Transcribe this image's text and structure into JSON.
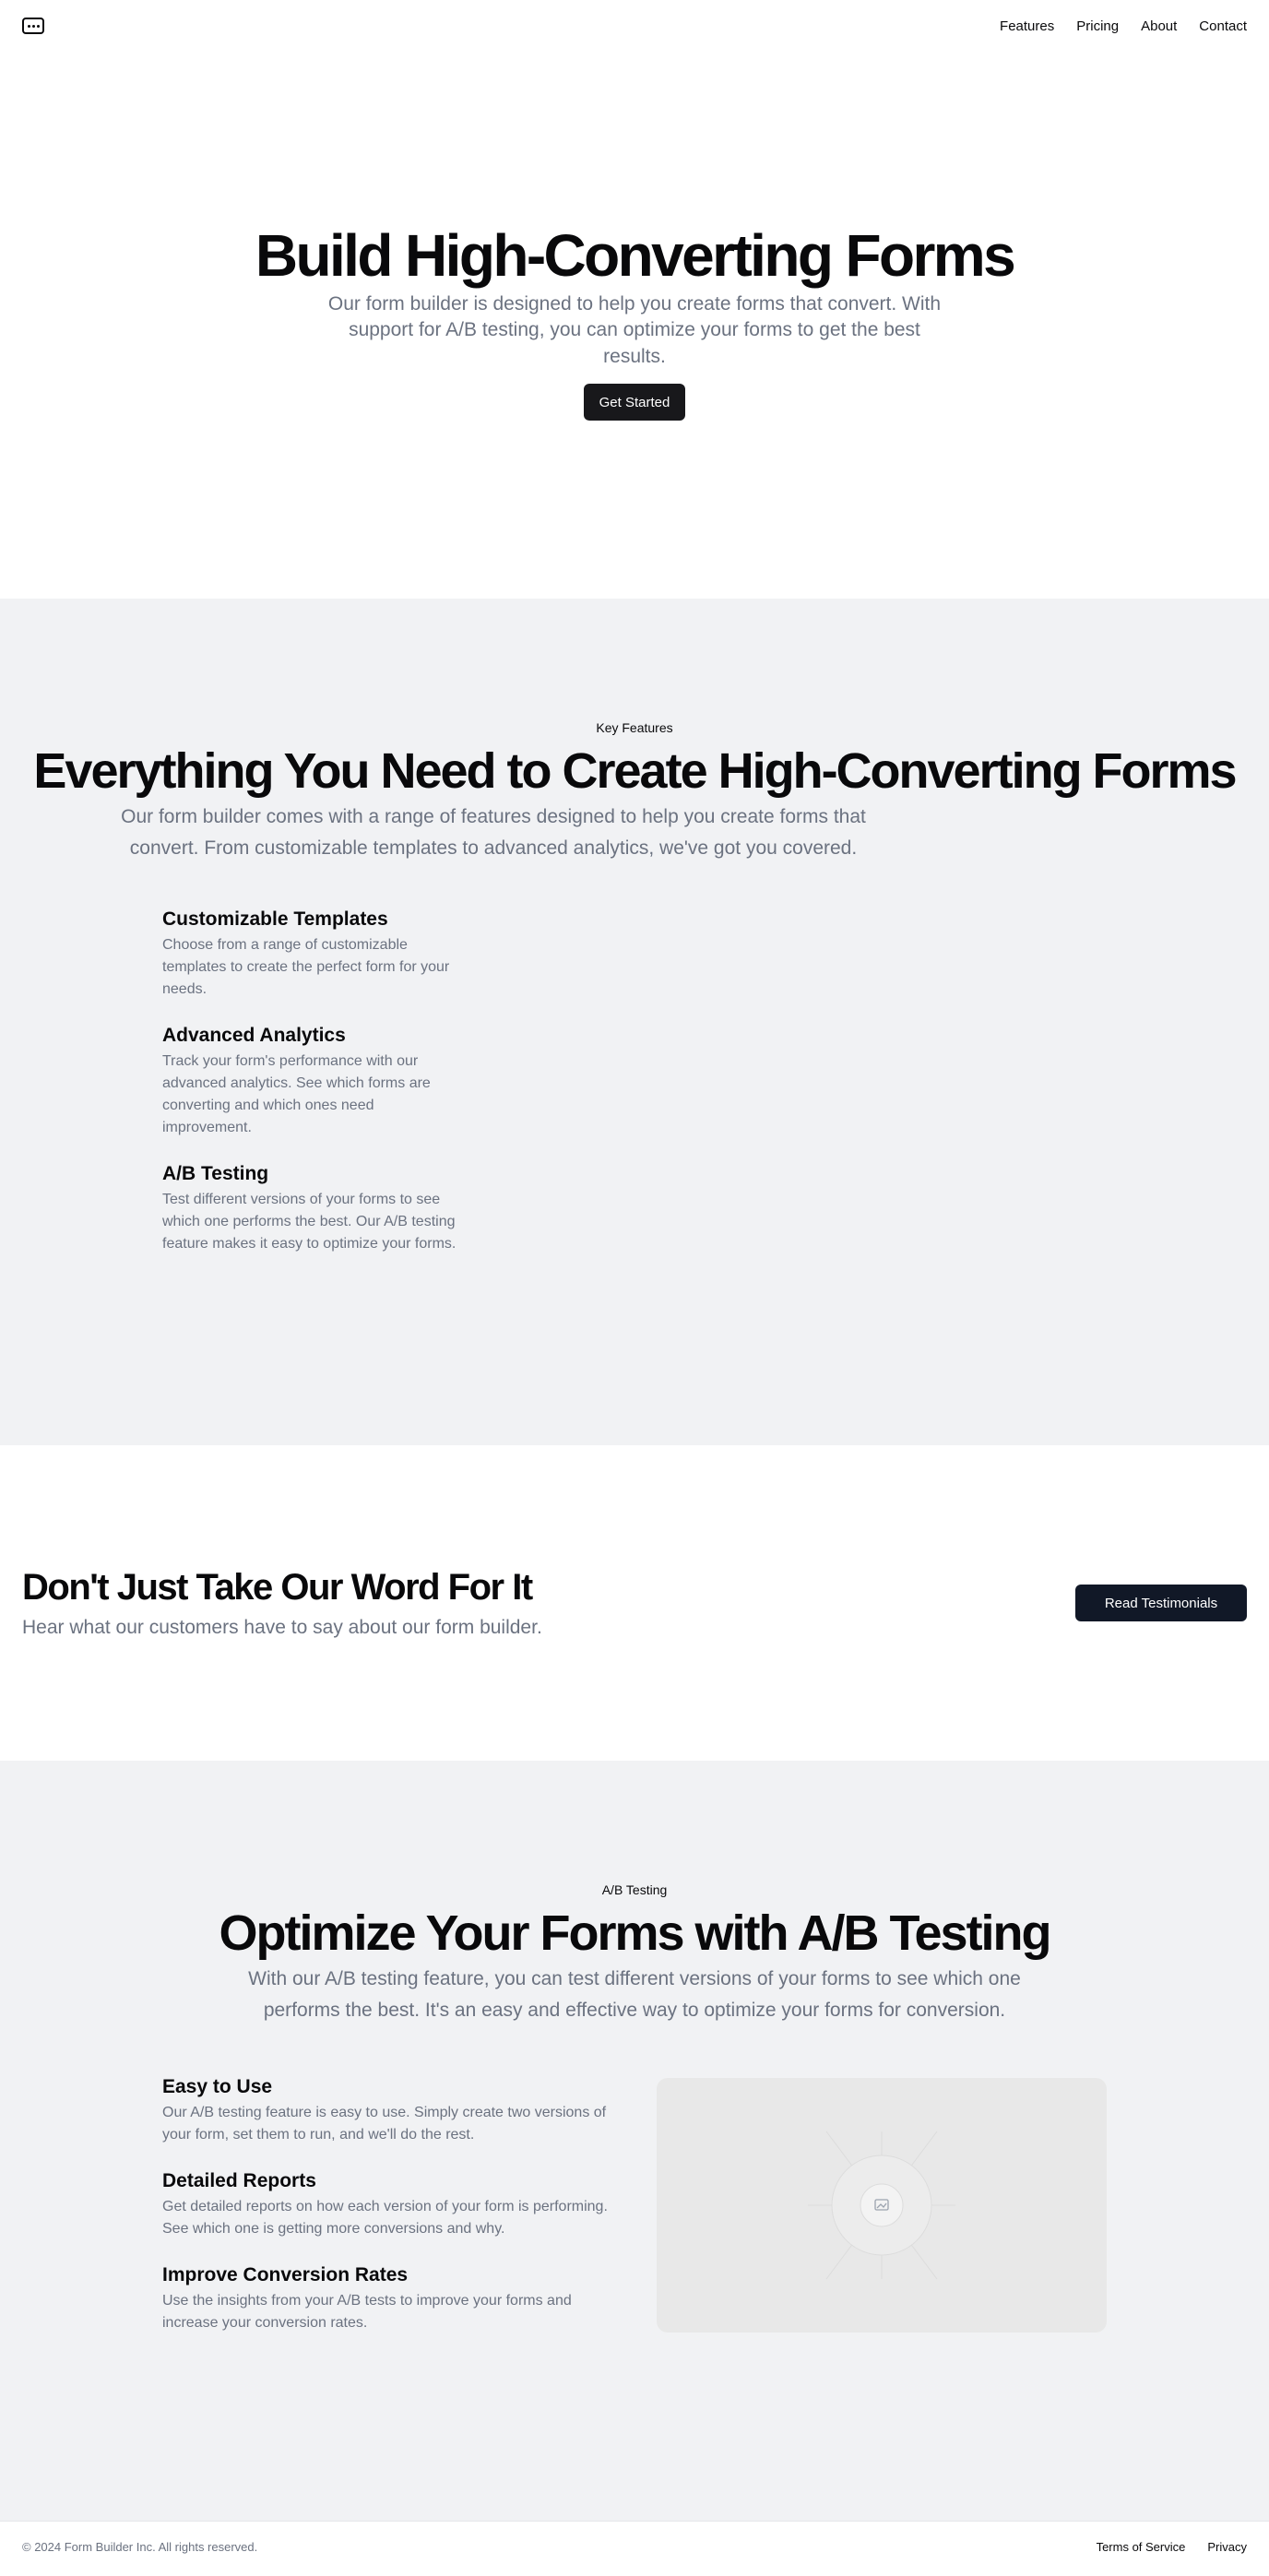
{
  "header": {
    "logo_icon": "keyboard-icon",
    "nav": [
      "Features",
      "Pricing",
      "About",
      "Contact"
    ]
  },
  "hero": {
    "title": "Build High-Converting Forms",
    "description": "Our form builder is designed to help you create forms that convert. With support for A/B testing, you can optimize your forms to get the best results.",
    "cta": "Get Started"
  },
  "features": {
    "eyebrow": "Key Features",
    "title": "Everything You Need to Create High-Converting Forms",
    "description": "Our form builder comes with a range of features designed to help you create forms that convert. From customizable templates to advanced analytics, we've got you covered.",
    "items": [
      {
        "title": "Customizable Templates",
        "text": "Choose from a range of customizable templates to create the perfect form for your needs."
      },
      {
        "title": "Advanced Analytics",
        "text": "Track your form's performance with our advanced analytics. See which forms are converting and which ones need improvement."
      },
      {
        "title": "A/B Testing",
        "text": "Test different versions of your forms to see which one performs the best. Our A/B testing feature makes it easy to optimize your forms."
      }
    ]
  },
  "testimonials": {
    "title": "Don't Just Take Our Word For It",
    "description": "Hear what our customers have to say about our form builder.",
    "cta": "Read Testimonials"
  },
  "ab": {
    "eyebrow": "A/B Testing",
    "title": "Optimize Your Forms with A/B Testing",
    "description": "With our A/B testing feature, you can test different versions of your forms to see which one performs the best. It's an easy and effective way to optimize your forms for conversion.",
    "items": [
      {
        "title": "Easy to Use",
        "text": "Our A/B testing feature is easy to use. Simply create two versions of your form, set them to run, and we'll do the rest."
      },
      {
        "title": "Detailed Reports",
        "text": "Get detailed reports on how each version of your form is performing. See which one is getting more conversions and why."
      },
      {
        "title": "Improve Conversion Rates",
        "text": "Use the insights from your A/B tests to improve your forms and increase your conversion rates."
      }
    ],
    "media_icon": "image-placeholder-icon"
  },
  "footer": {
    "copyright": "© 2024 Form Builder Inc. All rights reserved.",
    "links": [
      "Terms of Service",
      "Privacy"
    ]
  }
}
